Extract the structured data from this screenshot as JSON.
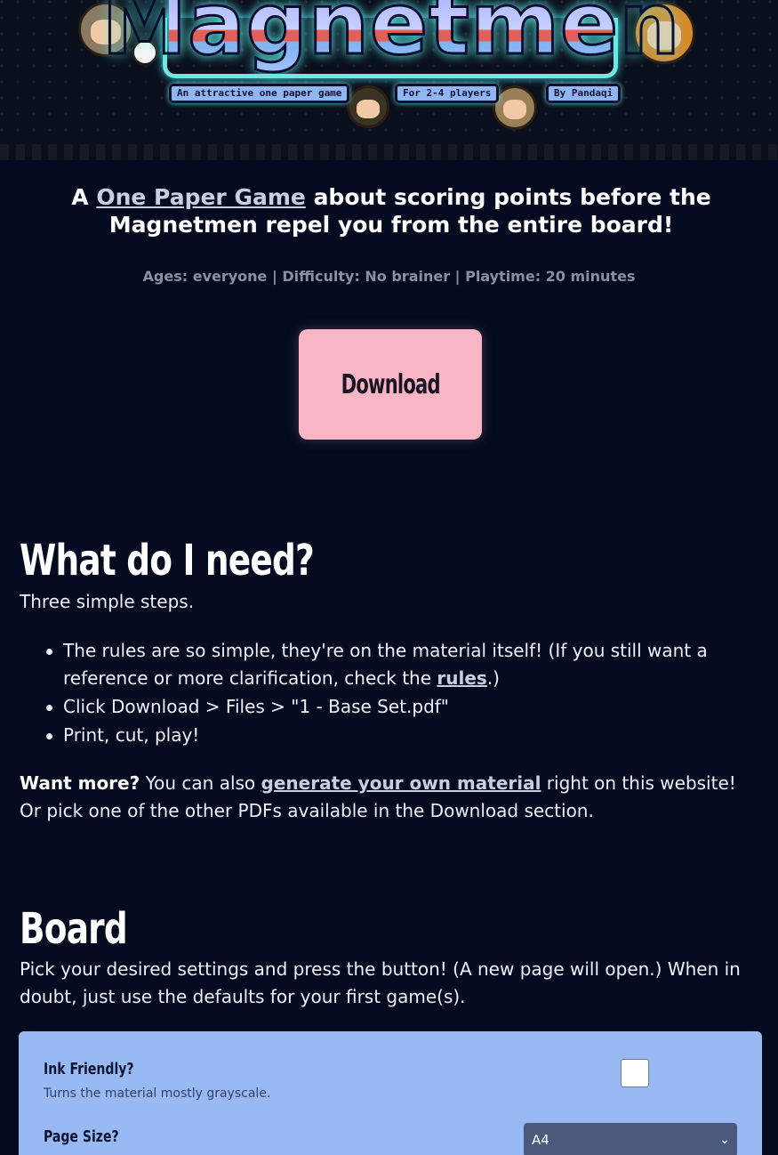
{
  "header": {
    "logo_title": "Magnetmen",
    "tag_tagline": "An attractive one paper game",
    "tag_players": "For 2-4 players",
    "tag_author": "By Pandaqi"
  },
  "intro": {
    "prefix": "A ",
    "link": "One Paper Game",
    "suffix": " about scoring points before the Magnetmen repel you from the entire board!",
    "meta": "Ages: everyone | Difficulty: No brainer | Playtime: 20 minutes"
  },
  "download_button": "Download",
  "what_do_i_need": {
    "heading": "What do I need?",
    "subtitle": "Three simple steps.",
    "steps": [
      {
        "text_before": "The rules are so simple, they're on the material itself! (If you still want a reference or more clarification, check the ",
        "link": "rules",
        "text_after": ".)"
      },
      {
        "text": "Click Download > Files > \"1 - Base Set.pdf\""
      },
      {
        "text": "Print, cut, play!"
      }
    ],
    "more_bold": "Want more?",
    "more_before": " You can also ",
    "more_link": "generate your own material",
    "more_after": " right on this website! Or pick one of the other PDFs available in the Download section."
  },
  "board": {
    "heading": "Board",
    "description": "Pick your desired settings and press the button! (A new page will open.) When in doubt, just use the defaults for your first game(s).",
    "settings": {
      "ink_friendly_label": "Ink Friendly?",
      "ink_friendly_desc": "Turns the material mostly grayscale.",
      "ink_friendly_checked": false,
      "page_size_label": "Page Size?",
      "page_size_value": "A4"
    }
  },
  "colors": {
    "background": "#040a1f",
    "download_button": "#f8b5c6",
    "panel": "#98b9f2",
    "select": "#4a5a7c"
  },
  "icons": [
    "soccer-ball-icon",
    "chevron-down-icon"
  ]
}
